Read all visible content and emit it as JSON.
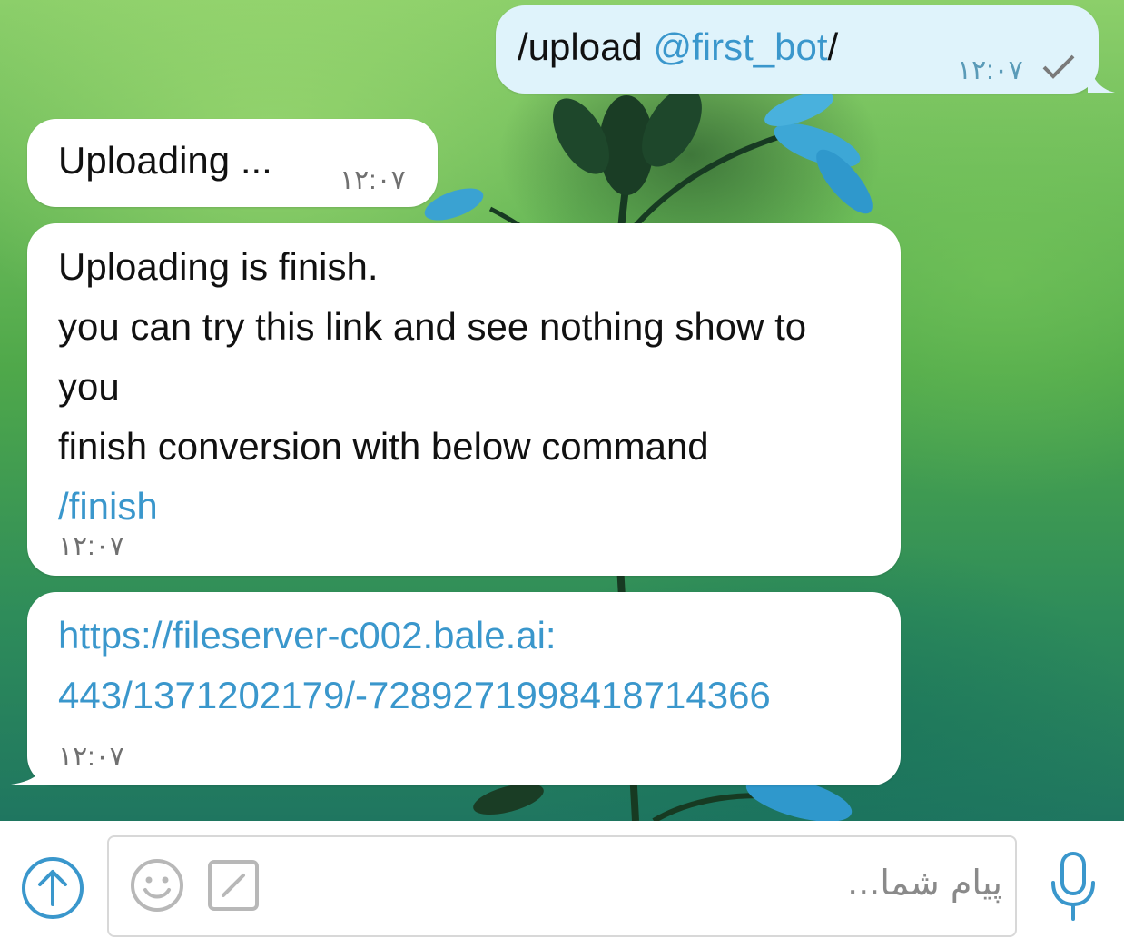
{
  "messages": [
    {
      "direction": "outgoing",
      "command": "/upload",
      "mention": "@first_bot",
      "suffix": "/",
      "time": "۱۲:۰۷",
      "status_icon": "check-icon"
    },
    {
      "direction": "incoming",
      "text": "Uploading ...",
      "time": "۱۲:۰۷"
    },
    {
      "direction": "incoming",
      "lines": [
        "Uploading is finish.",
        "you can try this link and see nothing show to",
        "you",
        "finish conversion with below command"
      ],
      "command_link": "/finish",
      "time": "۱۲:۰۷"
    },
    {
      "direction": "incoming",
      "link_lines": [
        "https://fileserver-c002.bale.ai:",
        "443/1371202179/-7289271998418714366"
      ],
      "time": "۱۲:۰۷"
    }
  ],
  "composer": {
    "placeholder": "پیام شما...",
    "attach_icon": "upload-arrow-icon",
    "emoji_icon": "smiley-icon",
    "command_icon": "slash-command-icon",
    "voice_icon": "microphone-icon"
  },
  "colors": {
    "link": "#3a97cc",
    "outgoing_bubble": "#dff3fb",
    "incoming_bubble": "#ffffff"
  }
}
